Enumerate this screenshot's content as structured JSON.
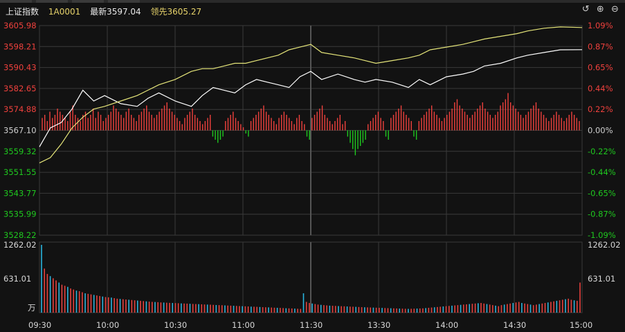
{
  "header": {
    "index_name": "上证指数",
    "code": "1A0001",
    "latest": "最新3597.04",
    "lead": "领先3605.27"
  },
  "controls": {
    "refresh_icon": "↺",
    "zoom_in_icon": "⊕",
    "zoom_out_icon": "⊖"
  },
  "colors": {
    "up": "#f0413d",
    "down": "#1fc91f",
    "flat": "#d0d0d0",
    "price_line": "#ffffff",
    "lead_line": "#e6e67a",
    "volume_up": "#e8413d",
    "volume_down": "#29b6e0",
    "grid": "#3a3a3a"
  },
  "chart_data": {
    "type": "line",
    "prev_close": 3567.1,
    "price_axis": {
      "left_labels": [
        "3605.98",
        "3598.21",
        "3590.43",
        "3582.65",
        "3574.88",
        "3567.10",
        "3559.32",
        "3551.55",
        "3543.77",
        "3535.99",
        "3528.22"
      ],
      "right_labels": [
        "1.09%",
        "0.87%",
        "0.65%",
        "0.44%",
        "0.22%",
        "0.00%",
        "-0.22%",
        "-0.44%",
        "-0.65%",
        "-0.87%",
        "-1.09%"
      ],
      "ylim": [
        3528.22,
        3605.98
      ]
    },
    "volume_axis": {
      "labels": [
        "1262.02",
        "631.01"
      ],
      "unit": "万",
      "ylim": [
        0,
        1262.02
      ]
    },
    "time_labels": [
      "09:30",
      "10:00",
      "10:30",
      "11:00",
      "11:30",
      "13:30",
      "14:00",
      "14:30",
      "15:00"
    ],
    "series": [
      {
        "key": "latest",
        "points": [
          [
            0,
            3561
          ],
          [
            0.02,
            3568
          ],
          [
            0.04,
            3570
          ],
          [
            0.06,
            3575
          ],
          [
            0.08,
            3582
          ],
          [
            0.1,
            3578
          ],
          [
            0.12,
            3580
          ],
          [
            0.15,
            3577
          ],
          [
            0.18,
            3576
          ],
          [
            0.2,
            3579
          ],
          [
            0.22,
            3581
          ],
          [
            0.25,
            3578
          ],
          [
            0.28,
            3576
          ],
          [
            0.3,
            3580
          ],
          [
            0.32,
            3583
          ],
          [
            0.34,
            3582
          ],
          [
            0.36,
            3581
          ],
          [
            0.38,
            3584
          ],
          [
            0.4,
            3586
          ],
          [
            0.42,
            3585
          ],
          [
            0.44,
            3584
          ],
          [
            0.46,
            3583
          ],
          [
            0.48,
            3587
          ],
          [
            0.5,
            3589
          ],
          [
            0.52,
            3586
          ],
          [
            0.55,
            3588
          ],
          [
            0.58,
            3586
          ],
          [
            0.6,
            3585
          ],
          [
            0.62,
            3586
          ],
          [
            0.65,
            3585
          ],
          [
            0.68,
            3583
          ],
          [
            0.7,
            3586
          ],
          [
            0.72,
            3584
          ],
          [
            0.75,
            3587
          ],
          [
            0.78,
            3588
          ],
          [
            0.8,
            3589
          ],
          [
            0.82,
            3591
          ],
          [
            0.85,
            3592
          ],
          [
            0.88,
            3594
          ],
          [
            0.9,
            3595
          ],
          [
            0.93,
            3596
          ],
          [
            0.96,
            3597
          ],
          [
            1.0,
            3597.04
          ]
        ]
      },
      {
        "key": "leading",
        "points": [
          [
            0,
            3555
          ],
          [
            0.02,
            3557
          ],
          [
            0.04,
            3562
          ],
          [
            0.06,
            3568
          ],
          [
            0.08,
            3572
          ],
          [
            0.1,
            3575
          ],
          [
            0.12,
            3576
          ],
          [
            0.15,
            3578
          ],
          [
            0.18,
            3580
          ],
          [
            0.2,
            3582
          ],
          [
            0.22,
            3584
          ],
          [
            0.25,
            3586
          ],
          [
            0.28,
            3589
          ],
          [
            0.3,
            3590
          ],
          [
            0.32,
            3590
          ],
          [
            0.34,
            3591
          ],
          [
            0.36,
            3592
          ],
          [
            0.38,
            3592
          ],
          [
            0.4,
            3593
          ],
          [
            0.42,
            3594
          ],
          [
            0.44,
            3595
          ],
          [
            0.46,
            3597
          ],
          [
            0.48,
            3598
          ],
          [
            0.5,
            3599
          ],
          [
            0.52,
            3596
          ],
          [
            0.55,
            3595
          ],
          [
            0.58,
            3594
          ],
          [
            0.6,
            3593
          ],
          [
            0.62,
            3592
          ],
          [
            0.65,
            3593
          ],
          [
            0.68,
            3594
          ],
          [
            0.7,
            3595
          ],
          [
            0.72,
            3597
          ],
          [
            0.75,
            3598
          ],
          [
            0.78,
            3599
          ],
          [
            0.8,
            3600
          ],
          [
            0.82,
            3601
          ],
          [
            0.85,
            3602
          ],
          [
            0.88,
            3603
          ],
          [
            0.9,
            3604
          ],
          [
            0.93,
            3605
          ],
          [
            0.96,
            3605.5
          ],
          [
            1.0,
            3605.27
          ]
        ]
      }
    ],
    "breadth_bars": {
      "note": "red up / green down histogram around the 0.00% line",
      "values": [
        4,
        5,
        3,
        6,
        4,
        5,
        7,
        6,
        5,
        4,
        3,
        6,
        8,
        5,
        4,
        3,
        5,
        6,
        4,
        5,
        7,
        4,
        6,
        5,
        3,
        4,
        5,
        6,
        8,
        7,
        6,
        5,
        4,
        6,
        7,
        5,
        4,
        3,
        5,
        6,
        7,
        8,
        6,
        5,
        4,
        5,
        6,
        7,
        8,
        9,
        7,
        6,
        5,
        4,
        3,
        2,
        4,
        5,
        6,
        7,
        5,
        4,
        3,
        2,
        3,
        4,
        5,
        -2,
        -3,
        -4,
        -3,
        -2,
        3,
        4,
        5,
        6,
        4,
        3,
        2,
        1,
        -1,
        -2,
        3,
        4,
        5,
        6,
        7,
        8,
        6,
        5,
        4,
        3,
        2,
        4,
        5,
        6,
        5,
        4,
        3,
        2,
        4,
        5,
        3,
        2,
        -2,
        -3,
        4,
        5,
        6,
        7,
        8,
        5,
        4,
        3,
        2,
        3,
        4,
        5,
        2,
        3,
        -2,
        -4,
        -6,
        -8,
        -6,
        -5,
        -4,
        -3,
        2,
        3,
        4,
        5,
        6,
        4,
        3,
        -2,
        -3,
        4,
        5,
        6,
        7,
        8,
        6,
        5,
        4,
        3,
        -2,
        -3,
        3,
        4,
        5,
        6,
        7,
        8,
        6,
        5,
        4,
        3,
        4,
        5,
        6,
        7,
        9,
        10,
        8,
        7,
        6,
        5,
        4,
        5,
        6,
        7,
        8,
        9,
        7,
        6,
        5,
        4,
        5,
        6,
        8,
        9,
        10,
        12,
        9,
        8,
        7,
        6,
        5,
        4,
        5,
        6,
        7,
        8,
        9,
        7,
        6,
        5,
        4,
        3,
        4,
        5,
        6,
        5,
        4,
        3,
        4,
        5,
        6,
        5,
        4,
        3
      ]
    },
    "volume": {
      "values": [
        1262,
        820,
        720,
        680,
        640,
        600,
        560,
        520,
        500,
        480,
        450,
        430,
        410,
        400,
        380,
        360,
        350,
        340,
        330,
        320,
        310,
        300,
        290,
        285,
        280,
        270,
        260,
        255,
        250,
        245,
        240,
        235,
        230,
        225,
        220,
        215,
        210,
        205,
        200,
        198,
        195,
        190,
        188,
        185,
        182,
        180,
        178,
        175,
        172,
        170,
        168,
        165,
        162,
        160,
        158,
        155,
        152,
        150,
        148,
        145,
        142,
        140,
        138,
        135,
        132,
        130,
        128,
        125,
        122,
        120,
        118,
        115,
        112,
        110,
        108,
        105,
        102,
        100,
        98,
        95,
        92,
        90,
        88,
        85,
        82,
        80,
        78,
        75,
        72,
        70,
        360,
        200,
        180,
        170,
        160,
        150,
        145,
        140,
        135,
        130,
        128,
        125,
        122,
        120,
        118,
        115,
        112,
        110,
        108,
        105,
        102,
        100,
        98,
        96,
        94,
        92,
        90,
        88,
        86,
        84,
        82,
        80,
        78,
        76,
        74,
        72,
        70,
        72,
        74,
        76,
        78,
        80,
        85,
        90,
        95,
        100,
        105,
        110,
        115,
        120,
        125,
        130,
        135,
        140,
        145,
        150,
        155,
        160,
        165,
        170,
        175,
        180,
        170,
        160,
        150,
        140,
        130,
        120,
        140,
        150,
        160,
        170,
        180,
        190,
        200,
        180,
        170,
        160,
        150,
        140,
        150,
        160,
        170,
        180,
        190,
        200,
        210,
        220,
        230,
        240,
        250,
        260,
        240,
        230,
        220,
        560
      ]
    }
  }
}
